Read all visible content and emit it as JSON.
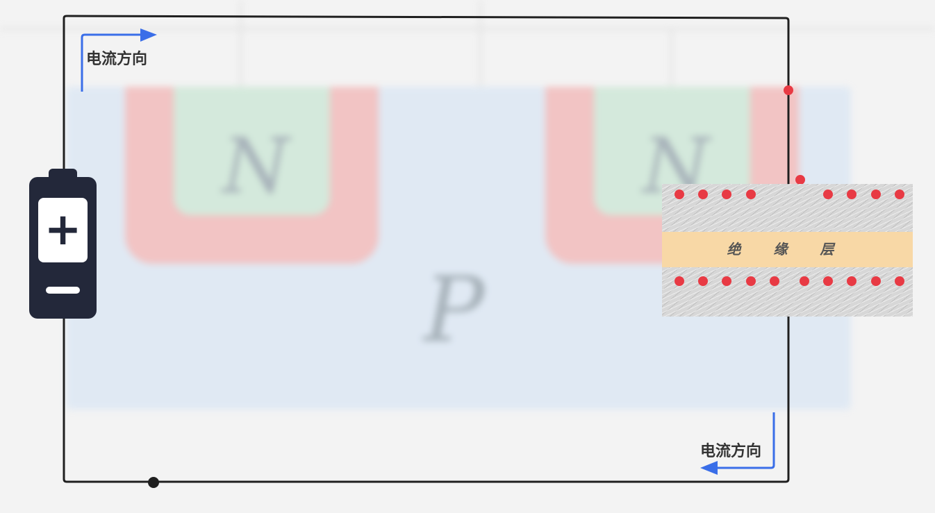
{
  "diagram": {
    "current_label_top": "电流方向",
    "current_label_bottom": "电流方向",
    "n_region_left": "N",
    "n_region_right": "N",
    "substrate_label": "P",
    "insulator_label": "绝 缘 层",
    "battery_plus": "+",
    "battery_minus": "−"
  },
  "colors": {
    "wire": "#1f1f1f",
    "arrow": "#3a6ee8",
    "charge": "#e83a44",
    "insulator": "#f8d8a6",
    "battery": "#23283a"
  }
}
